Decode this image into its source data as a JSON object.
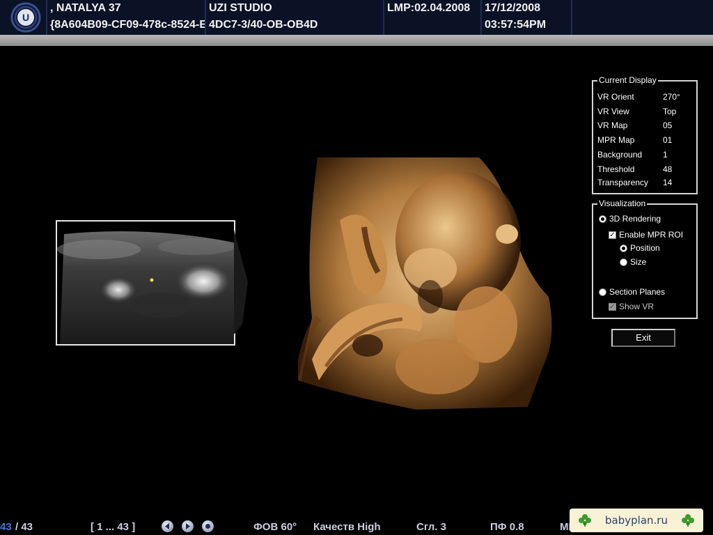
{
  "header": {
    "logo_letter": "U",
    "patient_name": ", NATALYA 37",
    "patient_id": "{8A604B09-CF09-478c-8524-E",
    "studio": "UZI STUDIO",
    "probe": "4DC7-3/40-OB-OB4D",
    "lmp": "LMP:02.04.2008",
    "date": "17/12/2008",
    "time": "03:57:54PM"
  },
  "current_display": {
    "title": "Current Display",
    "rows": [
      {
        "label": "VR Orient",
        "value": "270°"
      },
      {
        "label": "VR View",
        "value": "Top"
      },
      {
        "label": "VR Map",
        "value": "05"
      },
      {
        "label": "MPR Map",
        "value": "01"
      },
      {
        "label": "Background",
        "value": "1"
      },
      {
        "label": "Threshold",
        "value": "48"
      },
      {
        "label": "Transparency",
        "value": "14"
      }
    ]
  },
  "visualization": {
    "title": "Visualization",
    "rendering_3d": {
      "label": "3D Rendering",
      "selected": true
    },
    "enable_mpr_roi": {
      "label": "Enable MPR ROI",
      "checked": true
    },
    "position": {
      "label": "Position",
      "selected": true
    },
    "size": {
      "label": "Size",
      "selected": false
    },
    "section_planes": {
      "label": "Section Planes",
      "selected": false
    },
    "show_vr": {
      "label": "Show VR",
      "checked": true,
      "enabled": false
    }
  },
  "exit_label": "Exit",
  "footer": {
    "frame_current": "43",
    "frame_total": "/ 43",
    "frame_range": "[ 1 ... 43 ]",
    "fov": "ФОВ 60°",
    "quality": "Качеств High",
    "smoothing": "Сгл. 3",
    "pf": "ПФ 0.8",
    "truncated": "МГ"
  },
  "watermark": "babyplan.ru",
  "colors": {
    "header_bg": "#0c1226",
    "accent_blue": "#3e78e0",
    "render_tone": "#b07a3e",
    "watermark_bg": "#f7f2d6"
  }
}
